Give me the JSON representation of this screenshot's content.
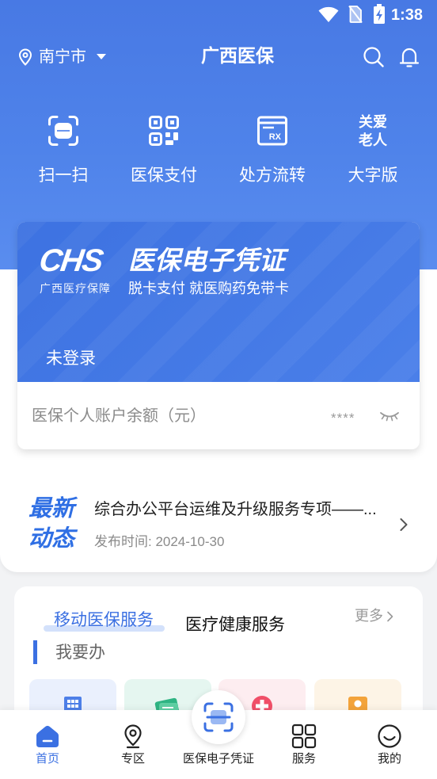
{
  "status_bar": {
    "time": "1:38",
    "icons": [
      "wifi-icon",
      "no-sim-icon",
      "battery-charging-icon"
    ]
  },
  "header": {
    "location": "南宁市",
    "location_icon": "location-pin-icon",
    "dropdown_icon": "caret-down-icon",
    "title": "广西医保",
    "actions": [
      {
        "icon": "search-icon"
      },
      {
        "icon": "bell-icon"
      }
    ]
  },
  "quick_actions": [
    {
      "label": "扫一扫",
      "icon": "scan-icon"
    },
    {
      "label": "医保支付",
      "icon": "qr-code-icon"
    },
    {
      "label": "处方流转",
      "icon": "prescription-icon",
      "icon_text": "RX"
    },
    {
      "label": "大字版",
      "icon": "elderly-care-icon",
      "icon_text": [
        "关爱",
        "老人"
      ]
    }
  ],
  "credential_card": {
    "logo": "CHS",
    "title": "医保电子凭证",
    "org": "广西医疗保障",
    "tagline": "脱卡支付 就医购药免带卡",
    "login_status": "未登录",
    "balance_label": "医保个人账户余额（元）",
    "balance_value": "****",
    "visibility_icon": "eye-closed-icon"
  },
  "news": {
    "badge": [
      "最新",
      "动态"
    ],
    "title": "综合办公平台运维及升级服务专项——...",
    "date": "发布时间: 2024-10-30",
    "icon": "chevron-right-icon"
  },
  "services": {
    "tabs": [
      {
        "label": "移动医保服务",
        "active": true
      },
      {
        "label": "医疗健康服务",
        "active": false
      }
    ],
    "more_label": "更多",
    "section_title": "我要办",
    "tiles": [
      {
        "icon": "building-icon"
      },
      {
        "icon": "card-icon"
      },
      {
        "icon": "plus-circle-icon"
      },
      {
        "icon": "person-icon"
      }
    ]
  },
  "bottom_nav": [
    {
      "label": "首页",
      "icon": "home-icon",
      "active": true
    },
    {
      "label": "专区",
      "icon": "location-pin-icon",
      "active": false
    },
    {
      "label": "医保电子凭证",
      "icon": "scan-icon",
      "active": false
    },
    {
      "label": "服务",
      "icon": "grid-icon",
      "active": false
    },
    {
      "label": "我的",
      "icon": "smiley-icon",
      "active": false
    }
  ],
  "colors": {
    "primary": "#3b70e2",
    "hero_bg": "#4a7de6",
    "page_bg": "#f2f3f5"
  }
}
